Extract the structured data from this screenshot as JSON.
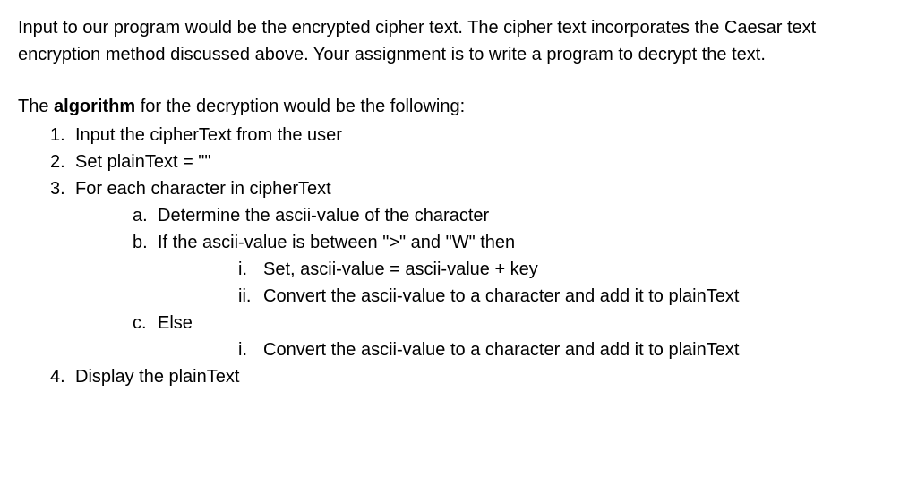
{
  "intro": "Input to our program would be the encrypted cipher text. The cipher text incorporates the Caesar text encryption method discussed above. Your assignment is to write a program to decrypt the text.",
  "algoHeading": {
    "prefix": "The ",
    "boldWord": "algorithm",
    "suffix": " for the decryption would be the following:"
  },
  "steps": {
    "s1": "Input the cipherText from the user",
    "s2": "Set plainText = \"\"",
    "s3": "For each character in cipherText",
    "s3a": "Determine the ascii-value of the character",
    "s3b": "If the ascii-value is between \">\" and \"W\" then",
    "s3b_i": "Set, ascii-value = ascii-value + key",
    "s3b_ii": "Convert the ascii-value to a character and add it to plainText",
    "s3c": "Else",
    "s3c_i": "Convert the ascii-value to a character and add it to plainText",
    "s4": "Display the plainText"
  }
}
